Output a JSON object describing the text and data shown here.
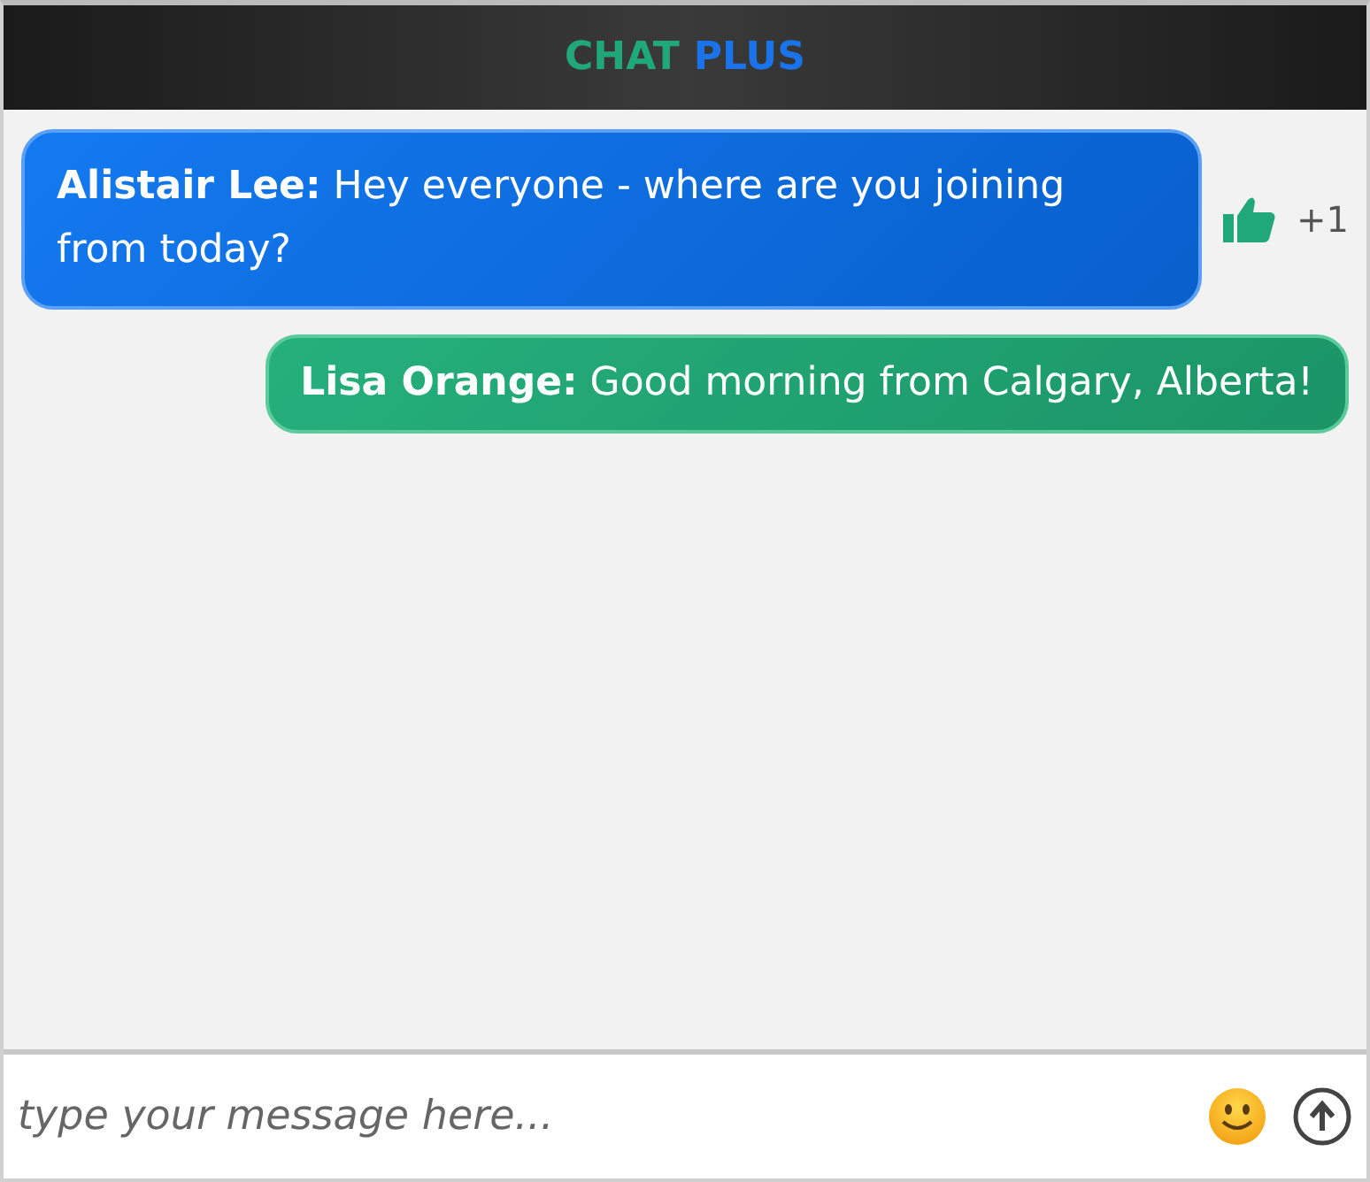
{
  "header": {
    "title_parts": [
      {
        "text": "CHAT",
        "color": "#21a87a"
      },
      {
        "text": "PLUS",
        "color": "#1a73e8"
      }
    ]
  },
  "messages": [
    {
      "kind": "incoming",
      "author": "Alistair Lee:",
      "text": "Hey everyone - where are you joining from today?",
      "reaction": {
        "count": "+1"
      }
    },
    {
      "kind": "outgoing",
      "author": "Lisa Orange:",
      "text": "Good morning from Calgary, Alberta!"
    }
  ],
  "composer": {
    "placeholder": "type your message here..."
  }
}
